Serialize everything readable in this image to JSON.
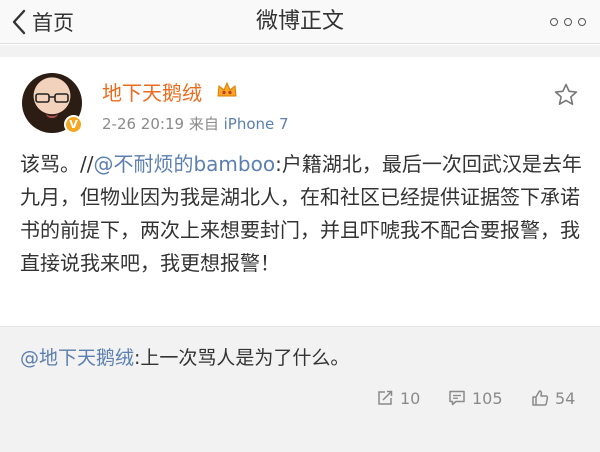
{
  "navbar": {
    "back_label": "首页",
    "title": "微博正文"
  },
  "post": {
    "author": "地下天鹅绒",
    "verified_badge": "V",
    "time": "2-26 20:19",
    "source_prefix": "来自",
    "source": "iPhone 7",
    "body_lead": "该骂。//",
    "body_mention": "@不耐烦的bamboo",
    "body_rest": ":户籍湖北，最后一次回武汉是去年九月，但物业因为我是湖北人，在和社区已经提供证据签下承诺书的前提下，两次上来想要封门，并且吓唬我不配合要报警，我直接说我来吧，我更想报警！"
  },
  "retweet": {
    "mention": "@地下天鹅绒",
    "text": ":上一次骂人是为了什么。"
  },
  "actions": {
    "repost_count": "10",
    "comment_count": "105",
    "like_count": "54"
  },
  "colors": {
    "username": "#e86c1f",
    "link": "#5b7fb0",
    "muted": "#8a8a8a",
    "panel": "#f2f2f2"
  },
  "icons": [
    "chevron-left-icon",
    "more-dots-icon",
    "crown-icon",
    "star-icon",
    "repost-icon",
    "comment-icon",
    "like-icon"
  ]
}
